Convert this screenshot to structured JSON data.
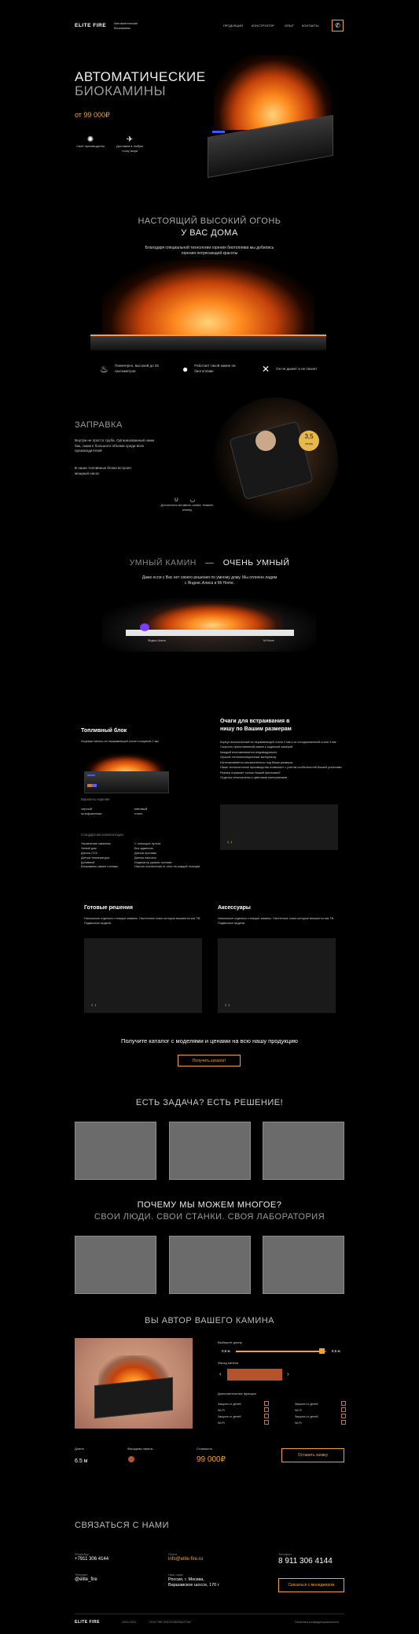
{
  "header": {
    "logo": "ELITE FIRE",
    "tagline": "Автоматические биокамины",
    "nav": [
      "ПРОДУКЦИЯ",
      "КОНСТРУКТОР",
      "ОПЫТ",
      "КОНТАКТЫ"
    ],
    "phone_icon": "phone-icon"
  },
  "hero": {
    "title_line1": "АВТОМАТИЧЕСКИЕ",
    "title_line2": "БИОКАМИНЫ",
    "price": "от 99 000₽",
    "features": [
      {
        "icon": "gear-icon",
        "text": "Своё производство"
      },
      {
        "icon": "delivery-icon",
        "text": "Доставка в любую точку мира"
      }
    ]
  },
  "fire_section": {
    "title_line1": "НАСТОЯЩИЙ ВЫСОКИЙ ОГОНЬ",
    "title_line2": "У ВАС ДОМА",
    "subtitle": "Благодаря специальной технологии горения биотоплива мы добились горения потрясающей красоты",
    "features": [
      {
        "icon": "flame-icon",
        "text": "Помечерно, высокий до 25 сантиметров"
      },
      {
        "icon": "bomb-icon",
        "text": "Работает такой камин на биотопливе"
      },
      {
        "icon": "cross-icon",
        "text": "Он не дымит и не пахнет"
      }
    ]
  },
  "refuel": {
    "title": "ЗАПРАВКА",
    "text1": "Внутри не просто труба. Организованный нами бак, самого большого объема среди всех производителей",
    "text2": "В наши топливные блоки встроен мощный насос",
    "badge_value": "3,5",
    "badge_unit": "литра",
    "magnet_icon": "magnet-icon",
    "magnet_text": "Достаточно вставить шланг. Нажать кнопку"
  },
  "smart": {
    "title_left": "УМНЫЙ КАМИН",
    "dash": "—",
    "title_right": "ОЧЕНЬ УМНЫЙ",
    "subtitle": "Даже если у Вас нет своего решения по умному дому. Мы отлично ладим с Яндекс.Алиса и Mi Home.",
    "label_left": "Яндекс.Алиса",
    "label_right": "Mi Home"
  },
  "fuel_block": {
    "title": "Топливный блок",
    "desc": "Лицевая панель из нержавеющей стали толщиной 2 мм",
    "variants_label": "Варианты изделия",
    "variants": [
      [
        "черный",
        "шлифованная"
      ],
      [
        "матовый",
        "сталь"
      ]
    ],
    "config_label": "Стандартная комплектация",
    "config_left": [
      "Управление камином",
      "Умный дом",
      "Датчик СО2",
      "Датчик температуры",
      "Доливной",
      "Биокамины камин топливо"
    ],
    "config_right": [
      "С помощью пульта",
      "Без админить",
      "Датчик пролива",
      "Датчик наклона",
      "Индикатор уровня топлива",
      "Наклон отключения от сети на каждой позиции"
    ]
  },
  "embed": {
    "title_line1": "Очаги для встраивания в",
    "title_line2": "нишу по Вашим размерам",
    "lines": [
      "Корпус выполненный из нержавеющей стали 2 мм и из холоднокатаной стали 3 мм",
      "Скорость приготовленый камин к заданной камерой",
      "Каждый изготавливается индивидуально",
      "Лучшие теплоизоляционные материалы",
      "Изготавливается исключительно под Ваши размеры",
      "Наше технологичное производство позволяет с учетом особенностей Вашей установки",
      "Размер отражает только Вашей фантазией",
      "Отделка стеклоклеем и цветными материалами"
    ]
  },
  "ready": {
    "title": "Готовые решения",
    "desc": "Напольные отдельно стоящие камины. Настенные очаги которые вешаются как ТВ. Подвесные модели."
  },
  "accessories": {
    "title": "Аксессуары",
    "desc": "Напольные отдельно стоящие камины. Настенные очаги которые вешаются как ТВ. Подвесные модели."
  },
  "catalog": {
    "text": "Получите каталог с моделями и ценами на всю нашу продукцию",
    "button": "Получить каталог!"
  },
  "task": {
    "title": "ЕСТЬ ЗАДАЧА? ЕСТЬ РЕШЕНИЕ!"
  },
  "why": {
    "title_line1": "ПОЧЕМУ МЫ МОЖЕМ МНОГОЕ?",
    "title_line2": "СВОИ ЛЮДИ. СВОИ СТАНКИ. СВОЯ ЛАБОРАТОРИЯ"
  },
  "author": {
    "title": "ВЫ АВТОР ВАШЕГО КАМИНА",
    "length_label": "Выберите длину",
    "len_min": "0.5 м",
    "len_max": "6.5 м",
    "length_value": 0.95,
    "color_label": "Фасад панели",
    "options_label": "Дополнительные функции",
    "options_left": [
      "Защита от детей",
      "Wi-Fi",
      "Защита от детей",
      "Wi-Fi"
    ],
    "options_right": [
      "Защита от детей",
      "Wi-Fi",
      "Защита от детей",
      "Wi-Fi"
    ],
    "summary_length_label": "Длина",
    "summary_length": "6.5 м",
    "summary_panel_label": "Фасадная панель",
    "summary_price_label": "Стоимость",
    "summary_price": "99 000₽",
    "order_button": "Оставить заявку"
  },
  "contact": {
    "title": "СВЯЗАТЬСЯ С НАМИ",
    "col1": [
      {
        "label": "WhatsApp",
        "value": "+7911 306 4144"
      },
      {
        "label": "Telegram",
        "value": "@elite_fire"
      }
    ],
    "col2": [
      {
        "label": "Почта",
        "value": "info@elite-fire.ru"
      },
      {
        "label": "Наш офис",
        "value": "Россия, г. Москва, Варшавское шоссе, 170 г"
      }
    ],
    "col3": [
      {
        "label": "Телефон",
        "value": "8 911 306 4144"
      }
    ],
    "manager_button": "Связаться с менеджером"
  },
  "footer": {
    "logo": "ELITE FIRE",
    "years": "2020-2021",
    "company": "ООО \"МЕТАЛЛООБРАБОТКА\"",
    "policy": "Политика конфиденциальности"
  },
  "colors": {
    "accent": "#f2a23a",
    "panel": "#1a1a1a",
    "copper": "#b5532b"
  }
}
